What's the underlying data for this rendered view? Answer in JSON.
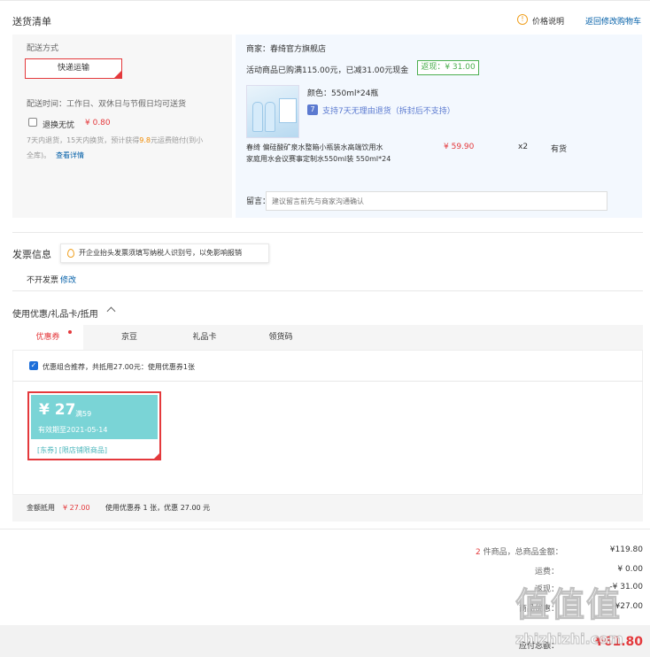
{
  "shipping_list": {
    "title": "送货清单",
    "price_note": "价格说明",
    "back_to_cart": "返回修改购物车"
  },
  "delivery": {
    "method_label": "配送方式",
    "method_value": "快递运输",
    "time_text": "配送时间：工作日、双休日与节假日均可送货",
    "worry_free_label": "退换无忧",
    "worry_free_price": "¥ 0.80",
    "desc_prefix": "7天内退货，15天内换货，预计获得",
    "desc_highlight": "9.8",
    "desc_suffix": "元运费赔付(到小",
    "desc_line2": "全库)。",
    "desc_link": "查看详情"
  },
  "merchant": {
    "label": "商家：",
    "name": "春绮官方旗舰店",
    "promo": "活动商品已购满115.00元，已减31.00元现金",
    "cashback": "返现：¥ 31.00",
    "color_label": "颜色：",
    "color_value": "550ml*24瓶",
    "return_badge": "7",
    "return_text": "支持7天无理由退货（拆封后不支持）",
    "product_title_line1": "春绮 偏硅酸矿泉水整箱小瓶装水高端饮用水",
    "product_title_line2": "家庭用水会议赛事定制水550ml装 550ml*24",
    "price": "¥ 59.90",
    "qty": "x2",
    "stock": "有货",
    "note_label": "留言：",
    "note_placeholder": "建议留言前先与商家沟通确认"
  },
  "invoice": {
    "title": "发票信息",
    "tip": "开企业抬头发票须填写纳税人识别号，以免影响报销",
    "status": "不开发票",
    "modify": "修改"
  },
  "discount": {
    "title": "使用优惠/礼品卡/抵用",
    "tabs": [
      "优惠券",
      "京豆",
      "礼品卡",
      "领货码"
    ],
    "recommend_text": "优惠组合推荐，共抵用27.00元：使用优惠券1张",
    "coupon": {
      "amount": "¥ 27",
      "threshold": "满59",
      "validity": "有效期至2021-05-14",
      "tags": "[东券] [限店铺限商品]"
    },
    "summary_label": "金额抵用",
    "summary_amount": "¥ 27.00",
    "summary_detail": "使用优惠券 1 张，优惠 27.00 元"
  },
  "totals": {
    "count": "2",
    "items_text": " 件商品，总商品金额：",
    "items_amount": "¥119.80",
    "freight_label": "运费：",
    "freight_amount": "¥ 0.00",
    "cashback_label": "返现：",
    "cashback_amount": "-¥ 31.00",
    "coupon_label": "商品优惠：",
    "coupon_amount": "-¥27.00",
    "payable_label": "应付总额：",
    "payable_amount": "¥61.80"
  },
  "watermark": {
    "text": "值值值",
    "domain": "zhizhizhi.com"
  }
}
